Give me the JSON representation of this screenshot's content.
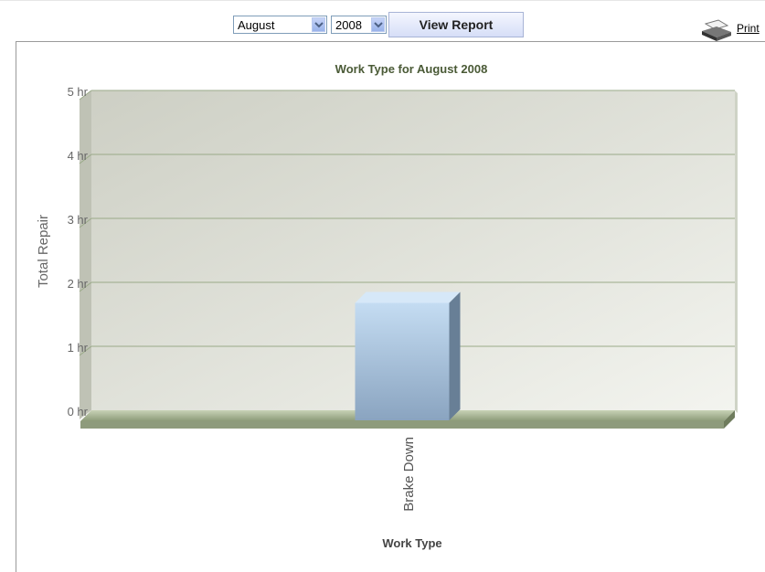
{
  "controls": {
    "month_select": "August",
    "year_select": "2008",
    "view_report_label": "View Report",
    "print_label": "Print"
  },
  "chart_data": {
    "type": "bar",
    "title": "Work Type for August 2008",
    "xlabel": "Work Type",
    "ylabel": "Total Repair",
    "categories": [
      "Brake Down"
    ],
    "values": [
      1.85
    ],
    "ylim": [
      0,
      5
    ],
    "yticks": [
      "0 hr",
      "1 hr",
      "2 hr",
      "3 hr",
      "4 hr",
      "5 hr"
    ],
    "grid": true,
    "style": "3d",
    "colors": {
      "bar": "#a9c4de",
      "grid": "#9aaa88",
      "title": "#4a5a36"
    }
  }
}
